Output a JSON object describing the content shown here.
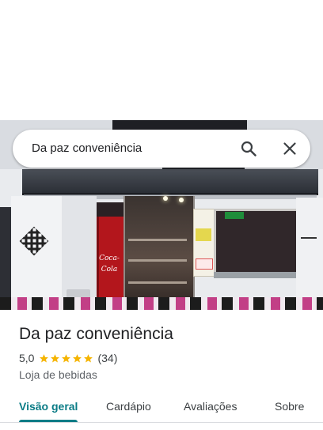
{
  "search": {
    "query": "Da paz conveniência",
    "search_icon": "search-icon",
    "close_icon": "close-icon"
  },
  "photo": {
    "fridge_text": "Coca-Cola"
  },
  "place": {
    "name": "Da paz conveniência",
    "rating": "5,0",
    "stars": 5,
    "review_count": "(34)",
    "category": "Loja de bebidas"
  },
  "tabs": [
    {
      "label": "Visão geral",
      "active": true
    },
    {
      "label": "Cardápio",
      "active": false
    },
    {
      "label": "Avaliações",
      "active": false
    },
    {
      "label": "Sobre",
      "active": false
    }
  ],
  "colors": {
    "accent": "#0b7c86",
    "star": "#f5b400"
  }
}
